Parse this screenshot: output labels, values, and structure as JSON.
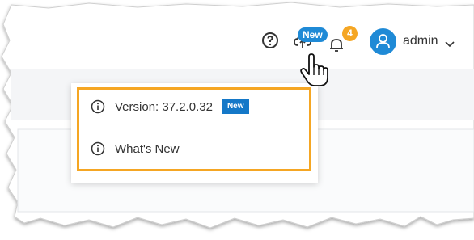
{
  "header": {
    "update_badge": "New",
    "notification_count": "4",
    "user_name": "admin"
  },
  "menu": {
    "items": [
      {
        "label": "Version: 37.2.0.32",
        "badge": "New"
      },
      {
        "label": "What's New"
      }
    ]
  },
  "colors": {
    "accent": "#1f8ad6",
    "badge_orange": "#f5a623",
    "highlight": "#f5a623",
    "menu_badge": "#1478c8"
  },
  "icons": [
    "help-icon",
    "cloud-upload-icon",
    "bell-icon",
    "user-icon",
    "chevron-down-icon",
    "info-icon",
    "hand-pointer-icon"
  ]
}
